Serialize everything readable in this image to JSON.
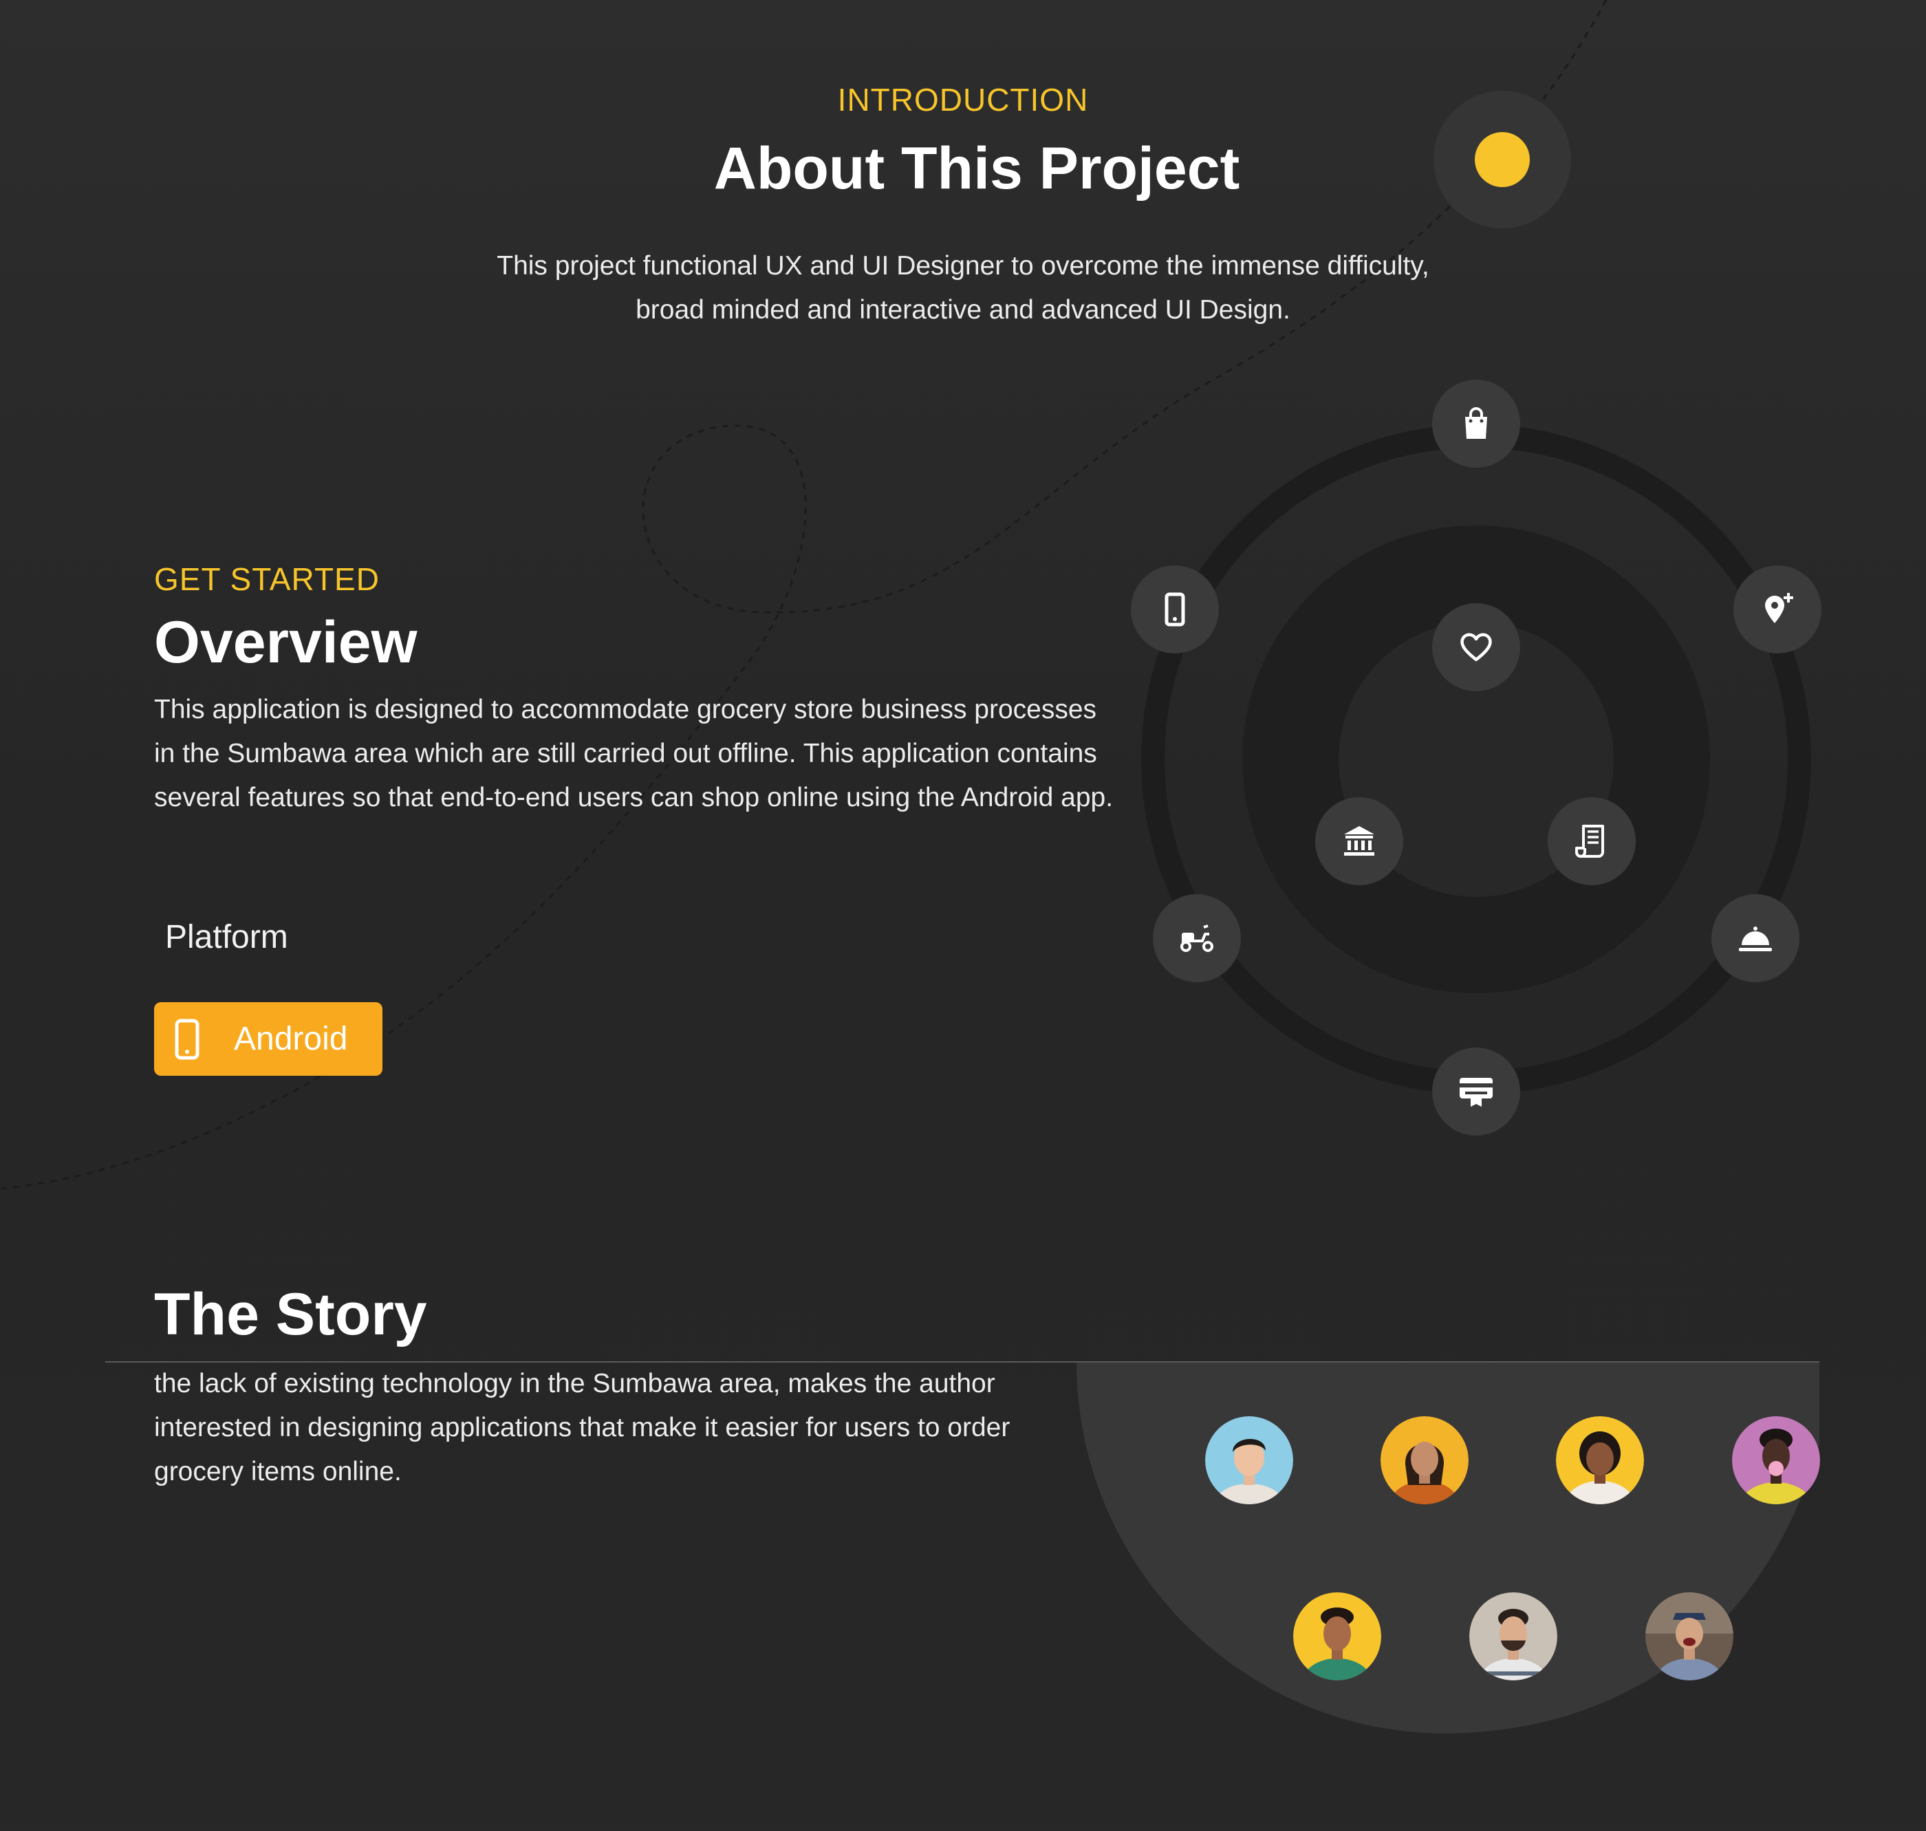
{
  "intro": {
    "eyebrow": "INTRODUCTION",
    "title": "About This Project",
    "description": "This project functional UX and UI Designer to overcome the immense difficulty, broad minded and interactive and advanced UI Design."
  },
  "overview": {
    "eyebrow": "GET STARTED",
    "title": "Overview",
    "description": "This application is designed to accommodate grocery store business processes in the Sumbawa area which are still carried out offline. This application contains several features so that end-to-end users can shop online using the Android app.",
    "platform_label": "Platform",
    "platform_button": {
      "label": "Android",
      "icon": "smartphone-icon"
    }
  },
  "feature_orbit": {
    "icons": [
      "shopping-bag-icon",
      "add-location-icon",
      "smartphone-icon",
      "heart-icon",
      "bank-icon",
      "receipt-icon",
      "scooter-icon",
      "food-cloche-icon",
      "pos-terminal-icon"
    ]
  },
  "story": {
    "title": "The Story",
    "description": "the lack of existing technology in the Sumbawa area, makes the author interested in designing applications that make it easier for users to order grocery items online.",
    "avatars": [
      {
        "bg": "#8ecde6"
      },
      {
        "bg": "#f4b42a"
      },
      {
        "bg": "#f7c52b"
      },
      {
        "bg": "#c27ab8"
      },
      {
        "bg": "#f7c52b"
      },
      {
        "bg": "#c9c0b6"
      },
      {
        "bg": "#6b5a4e"
      }
    ]
  },
  "colors": {
    "accent_yellow": "#f7c52b",
    "button_orange": "#f8a91e",
    "background": "#2a2a2a"
  }
}
